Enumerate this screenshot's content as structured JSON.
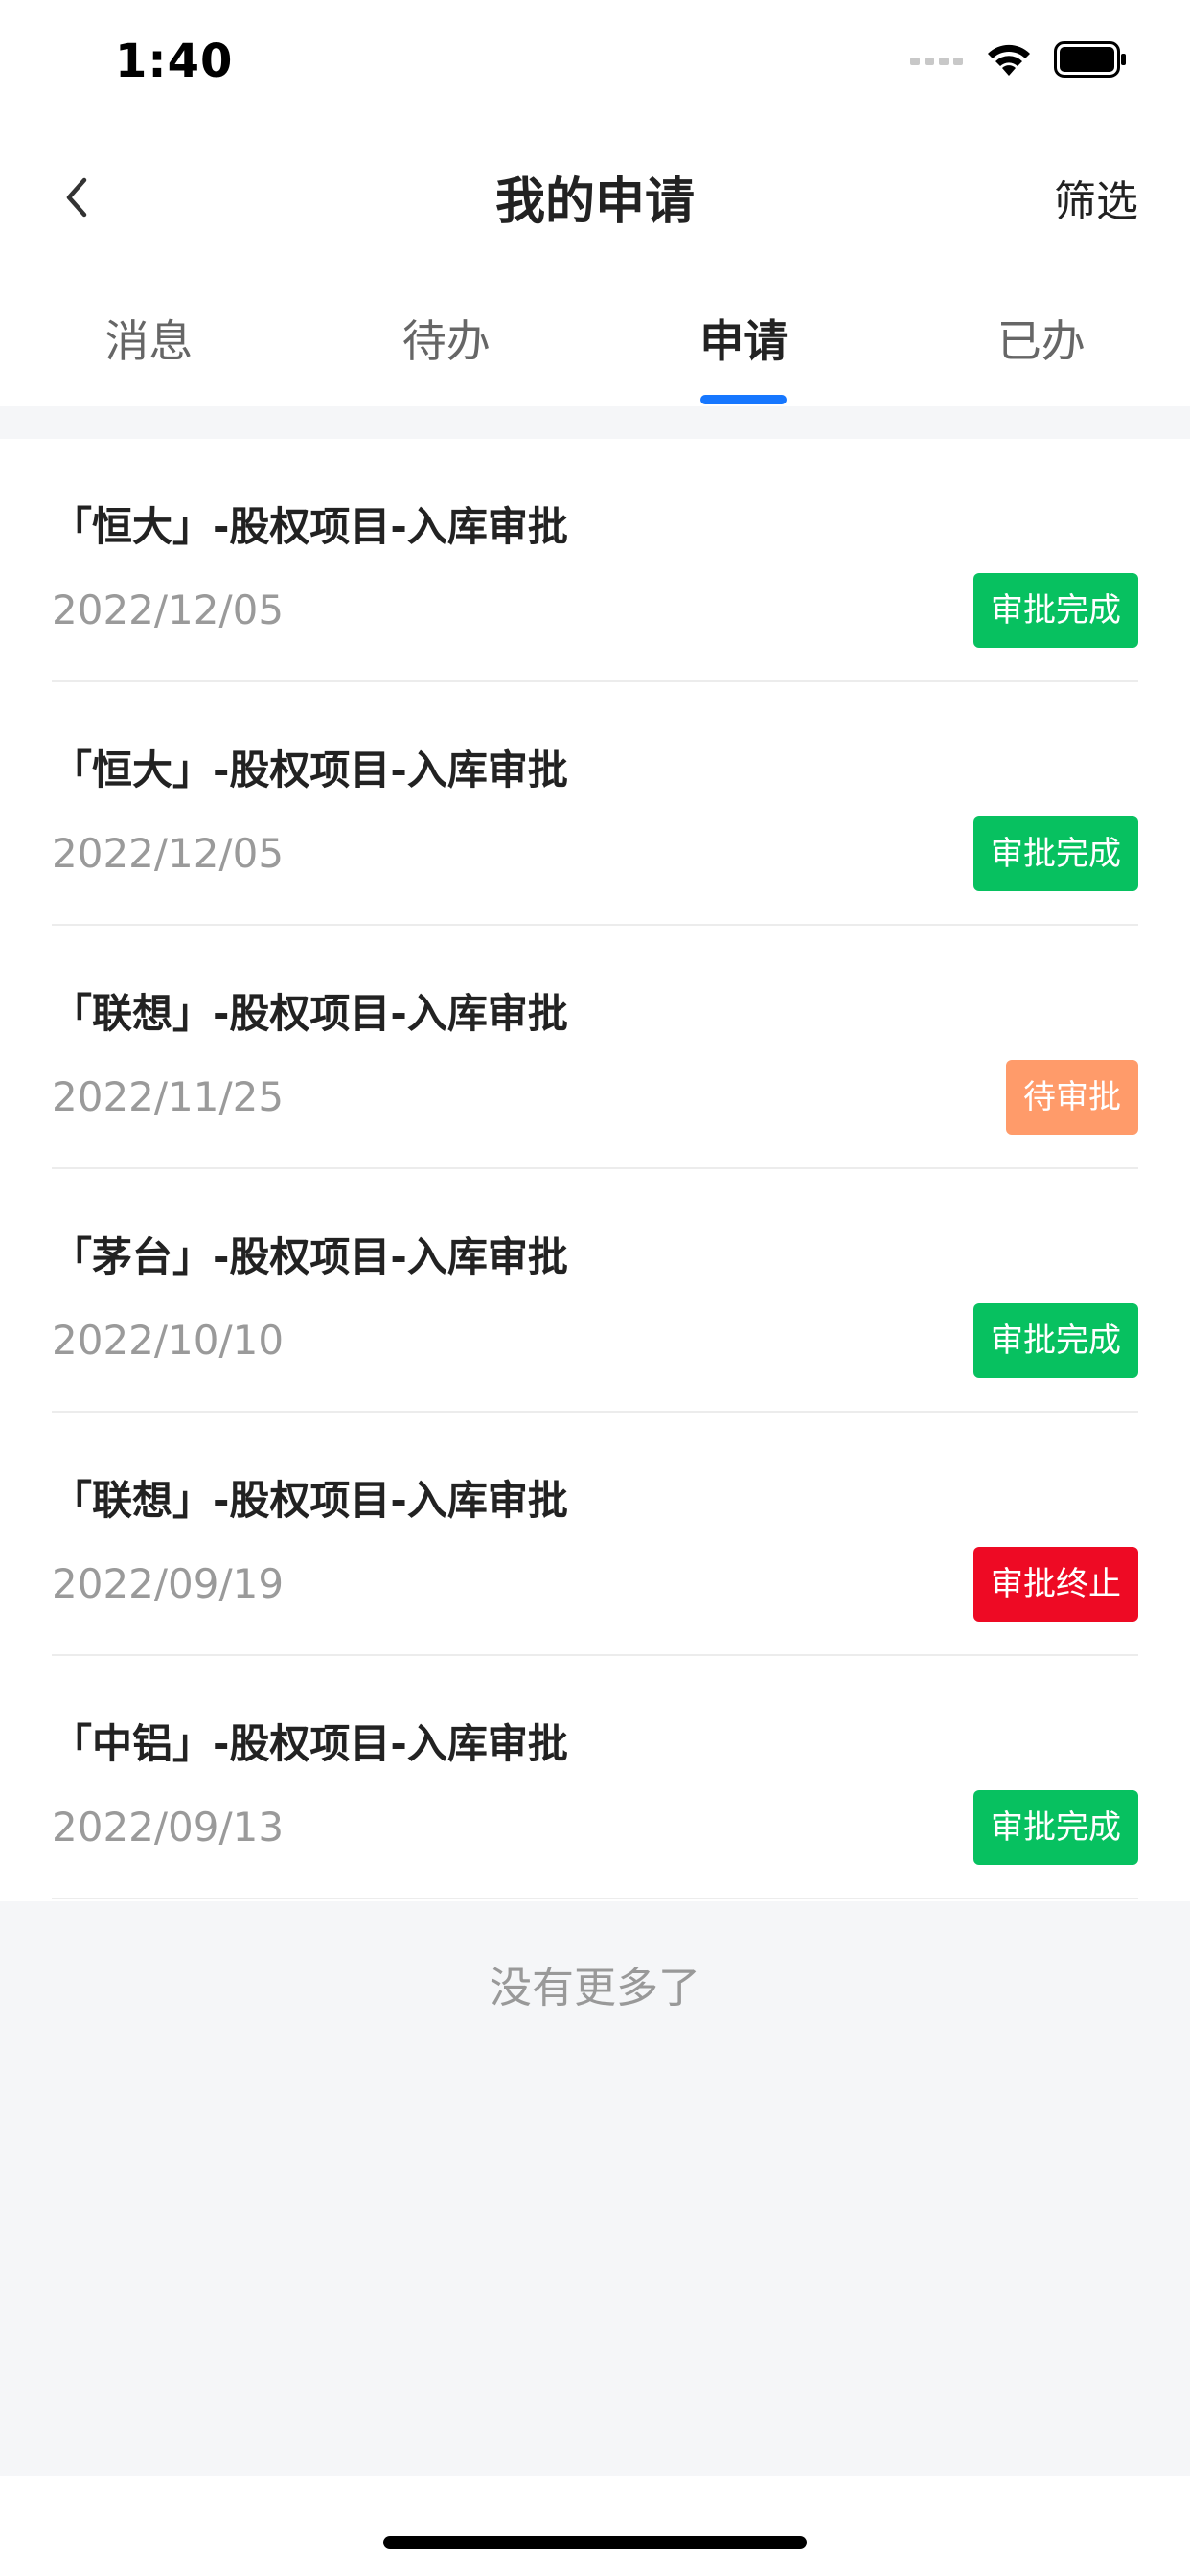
{
  "status_bar": {
    "time": "1:40",
    "icons": [
      "signal-icon",
      "wifi-icon",
      "battery-icon"
    ]
  },
  "nav": {
    "back_icon": "chevron-left-icon",
    "title": "我的申请",
    "action": "筛选"
  },
  "tabs": [
    {
      "label": "消息",
      "active": false
    },
    {
      "label": "待办",
      "active": false
    },
    {
      "label": "申请",
      "active": true
    },
    {
      "label": "已办",
      "active": false
    }
  ],
  "accent_color": "#1677ff",
  "items": [
    {
      "title": "「恒大」-股权项目-入库审批",
      "date": "2022/12/05",
      "status": "审批完成",
      "status_color": "#07c160"
    },
    {
      "title": "「恒大」-股权项目-入库审批",
      "date": "2022/12/05",
      "status": "审批完成",
      "status_color": "#07c160"
    },
    {
      "title": "「联想」-股权项目-入库审批",
      "date": "2022/11/25",
      "status": "待审批",
      "status_color": "#ff9b6a"
    },
    {
      "title": "「茅台」-股权项目-入库审批",
      "date": "2022/10/10",
      "status": "审批完成",
      "status_color": "#07c160"
    },
    {
      "title": "「联想」-股权项目-入库审批",
      "date": "2022/09/19",
      "status": "审批终止",
      "status_color": "#ee0a24"
    },
    {
      "title": "「中铝」-股权项目-入库审批",
      "date": "2022/09/13",
      "status": "审批完成",
      "status_color": "#07c160"
    }
  ],
  "footer_text": "没有更多了"
}
